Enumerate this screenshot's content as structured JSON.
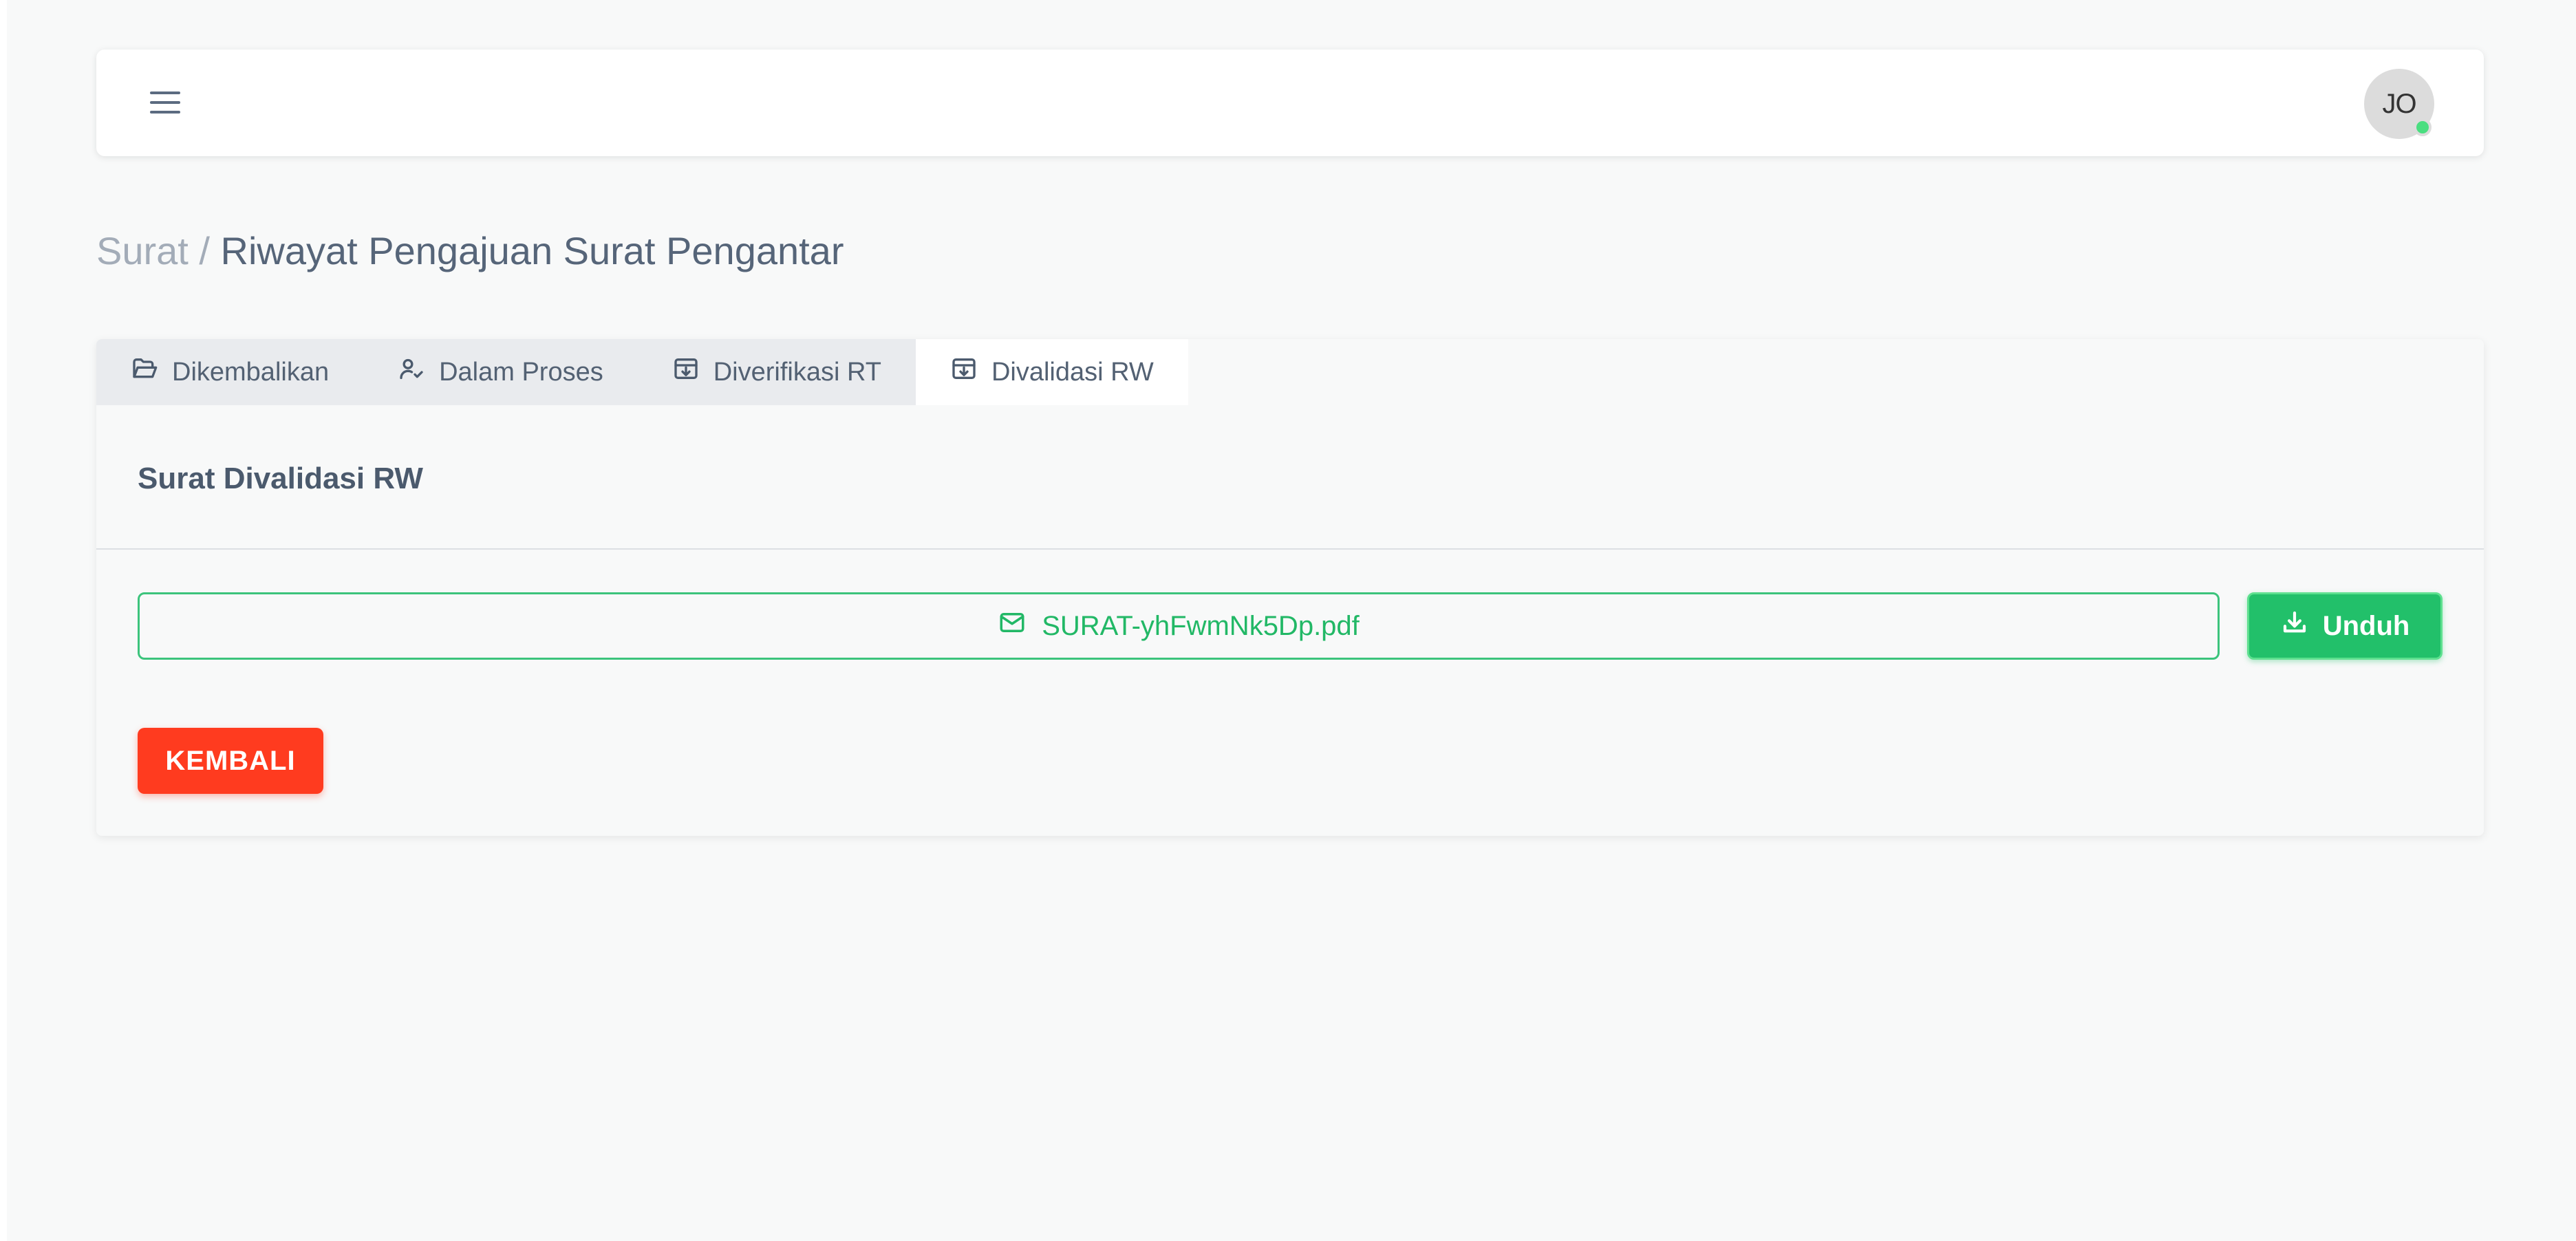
{
  "header": {
    "menu_icon": "hamburger-menu-icon",
    "avatar_initials": "JO",
    "status_color": "#4ade80"
  },
  "breadcrumb": {
    "root": "Surat",
    "separator": "/",
    "current": "Riwayat Pengajuan Surat Pengantar"
  },
  "tabs": [
    {
      "label": "Dikembalikan",
      "icon": "folder-open-icon",
      "active": false
    },
    {
      "label": "Dalam Proses",
      "icon": "user-check-icon",
      "active": false
    },
    {
      "label": "Diverifikasi RT",
      "icon": "archive-download-icon",
      "active": false
    },
    {
      "label": "Divalidasi RW",
      "icon": "archive-download-icon",
      "active": true
    }
  ],
  "section": {
    "title": "Surat Divalidasi RW"
  },
  "file": {
    "icon": "envelope-icon",
    "name": "SURAT-yhFwmNk5Dp.pdf"
  },
  "actions": {
    "download_label": "Unduh",
    "download_icon": "download-icon",
    "back_label": "KEMBALI"
  },
  "colors": {
    "accent_green": "#22c06a",
    "danger_red": "#ff3b1f",
    "text_muted": "#a3acb8"
  }
}
